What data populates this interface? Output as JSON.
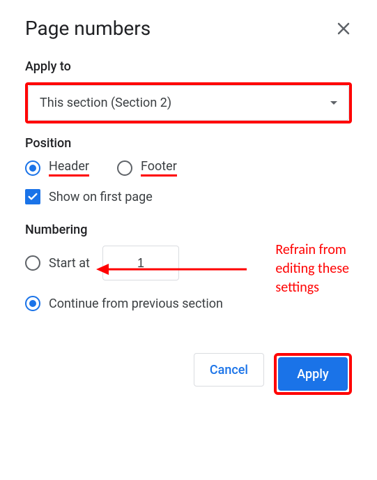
{
  "dialog": {
    "title": "Page numbers"
  },
  "applyTo": {
    "label": "Apply to",
    "selected": "This section (Section 2)"
  },
  "position": {
    "label": "Position",
    "options": {
      "header": "Header",
      "footer": "Footer"
    },
    "showFirstPage": "Show on first page"
  },
  "numbering": {
    "label": "Numbering",
    "startAt": "Start at",
    "startValue": "1",
    "continue": "Continue from previous section"
  },
  "buttons": {
    "cancel": "Cancel",
    "apply": "Apply"
  },
  "annotation": {
    "line1": "Refrain from",
    "line2": "editing these",
    "line3": "settings"
  }
}
